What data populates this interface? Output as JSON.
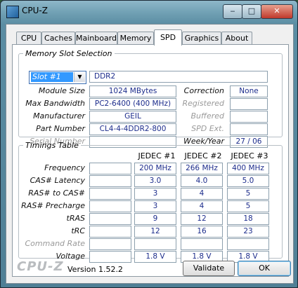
{
  "window": {
    "title": "CPU-Z",
    "controls": {
      "minimize": "‒",
      "maximize": "□",
      "close": "✕"
    }
  },
  "tabs": [
    "CPU",
    "Caches",
    "Mainboard",
    "Memory",
    "SPD",
    "Graphics",
    "About"
  ],
  "active_tab": "SPD",
  "slot": {
    "legend": "Memory Slot Selection",
    "selected": "Slot #1",
    "type": "DDR2",
    "fields": {
      "module_size": {
        "label": "Module Size",
        "value": "1024 MBytes"
      },
      "max_bandwidth": {
        "label": "Max Bandwidth",
        "value": "PC2-6400 (400 MHz)"
      },
      "manufacturer": {
        "label": "Manufacturer",
        "value": "GEIL"
      },
      "part_number": {
        "label": "Part Number",
        "value": "CL4-4-4DDR2-800"
      },
      "serial_number": {
        "label": "Serial Number",
        "value": ""
      }
    },
    "right_fields": {
      "correction": {
        "label": "Correction",
        "value": "None"
      },
      "registered": {
        "label": "Registered",
        "value": ""
      },
      "buffered": {
        "label": "Buffered",
        "value": ""
      },
      "spd_ext": {
        "label": "SPD Ext.",
        "value": ""
      },
      "week_year": {
        "label": "Week/Year",
        "value": "27 / 06"
      }
    }
  },
  "timings": {
    "legend": "Timings Table",
    "columns": [
      "JEDEC #1",
      "JEDEC #2",
      "JEDEC #3"
    ],
    "rows": [
      {
        "label": "Frequency",
        "values": [
          "200 MHz",
          "266 MHz",
          "400 MHz"
        ],
        "dim": false
      },
      {
        "label": "CAS# Latency",
        "values": [
          "3.0",
          "4.0",
          "5.0"
        ],
        "dim": false
      },
      {
        "label": "RAS# to CAS#",
        "values": [
          "3",
          "4",
          "5"
        ],
        "dim": false
      },
      {
        "label": "RAS# Precharge",
        "values": [
          "3",
          "4",
          "5"
        ],
        "dim": false
      },
      {
        "label": "tRAS",
        "values": [
          "9",
          "12",
          "18"
        ],
        "dim": false
      },
      {
        "label": "tRC",
        "values": [
          "12",
          "16",
          "23"
        ],
        "dim": false
      },
      {
        "label": "Command Rate",
        "values": [
          "",
          "",
          ""
        ],
        "dim": true
      },
      {
        "label": "Voltage",
        "values": [
          "1.8 V",
          "1.8 V",
          "1.8 V"
        ],
        "dim": false
      }
    ]
  },
  "footer": {
    "logo": "CPU-Z",
    "version": "Version 1.52.2",
    "validate": "Validate",
    "ok": "OK"
  }
}
